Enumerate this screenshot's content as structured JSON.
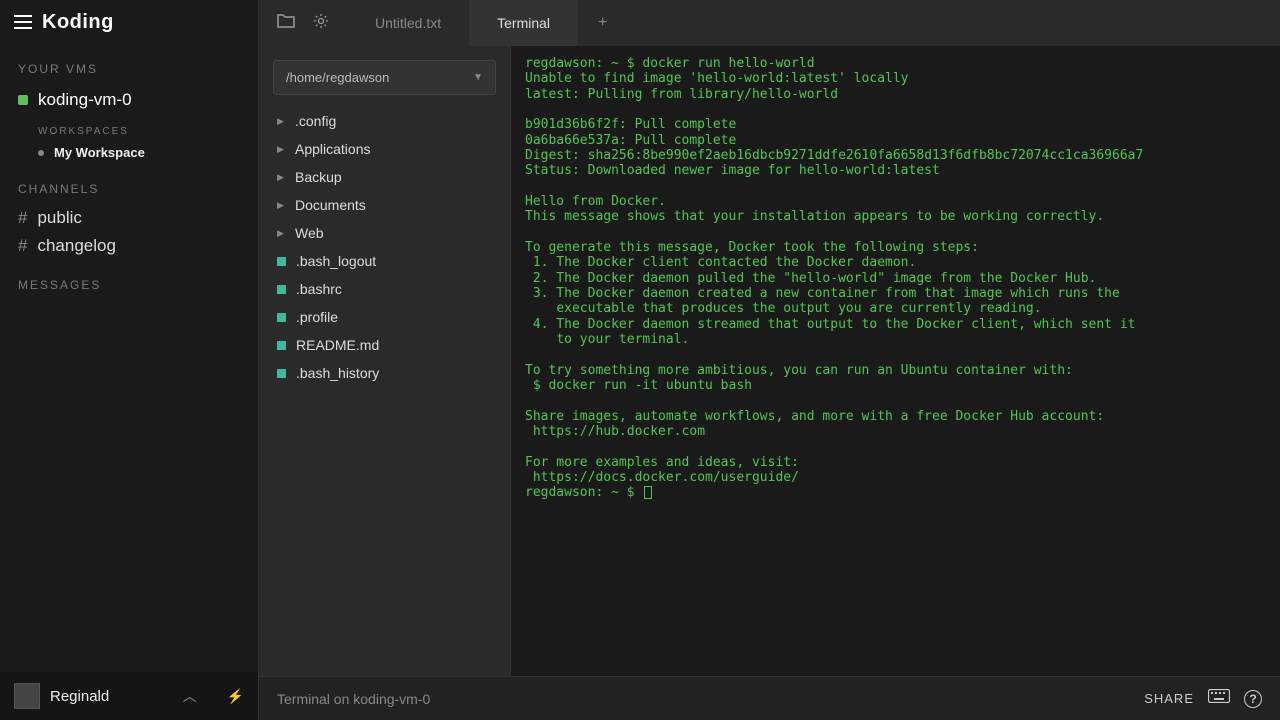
{
  "brand": "Koding",
  "sidebar": {
    "vms_label": "YOUR VMS",
    "vm_name": "koding-vm-0",
    "workspaces_label": "WORKSPACES",
    "workspace_name": "My Workspace",
    "channels_label": "CHANNELS",
    "channels": [
      "public",
      "changelog"
    ],
    "messages_label": "MESSAGES"
  },
  "user": {
    "name": "Reginald"
  },
  "tabs": {
    "items": [
      {
        "label": "Untitled.txt",
        "active": false
      },
      {
        "label": "Terminal",
        "active": true
      }
    ]
  },
  "filepanel": {
    "path": "/home/regdawson",
    "folders": [
      ".config",
      "Applications",
      "Backup",
      "Documents",
      "Web"
    ],
    "files": [
      ".bash_logout",
      ".bashrc",
      ".profile",
      "README.md",
      ".bash_history"
    ]
  },
  "terminal": {
    "output": "regdawson: ~ $ docker run hello-world\nUnable to find image 'hello-world:latest' locally\nlatest: Pulling from library/hello-world\n\nb901d36b6f2f: Pull complete\n0a6ba66e537a: Pull complete\nDigest: sha256:8be990ef2aeb16dbcb9271ddfe2610fa6658d13f6dfb8bc72074cc1ca36966a7\nStatus: Downloaded newer image for hello-world:latest\n\nHello from Docker.\nThis message shows that your installation appears to be working correctly.\n\nTo generate this message, Docker took the following steps:\n 1. The Docker client contacted the Docker daemon.\n 2. The Docker daemon pulled the \"hello-world\" image from the Docker Hub.\n 3. The Docker daemon created a new container from that image which runs the\n    executable that produces the output you are currently reading.\n 4. The Docker daemon streamed that output to the Docker client, which sent it\n    to your terminal.\n\nTo try something more ambitious, you can run an Ubuntu container with:\n $ docker run -it ubuntu bash\n\nShare images, automate workflows, and more with a free Docker Hub account:\n https://hub.docker.com\n\nFor more examples and ideas, visit:\n https://docs.docker.com/userguide/\n",
    "prompt": "regdawson: ~ $ "
  },
  "statusbar": {
    "text": "Terminal on koding-vm-0",
    "share": "SHARE"
  }
}
